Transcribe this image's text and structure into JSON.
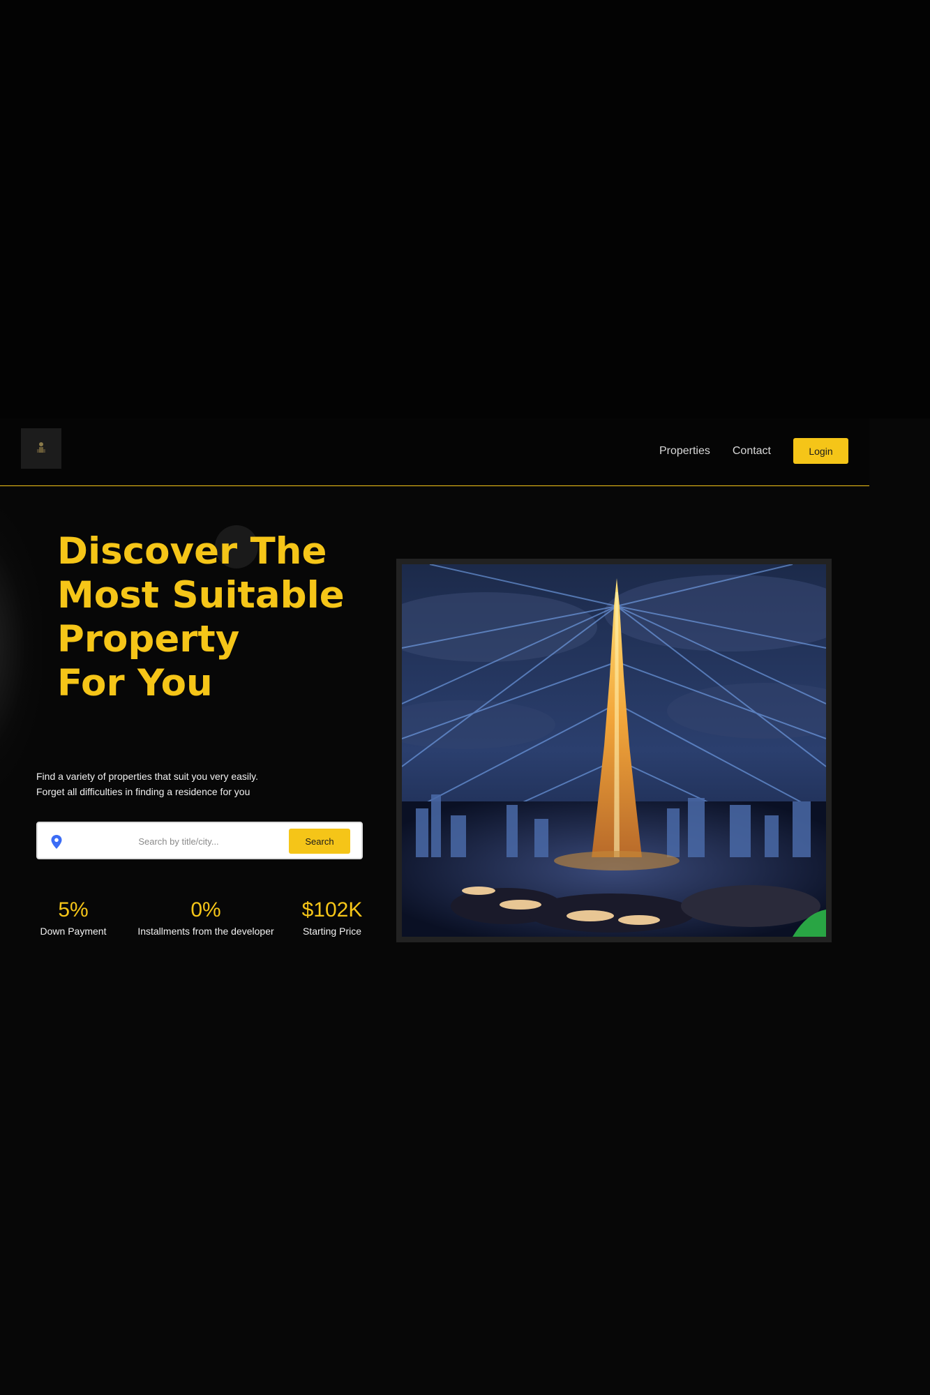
{
  "header": {
    "logo": "logo-icon",
    "nav": [
      {
        "label": "Properties"
      },
      {
        "label": "Contact"
      }
    ],
    "login_label": "Login"
  },
  "hero": {
    "title_lines": [
      "Discover The",
      "Most Suitable",
      "Property",
      "For You"
    ],
    "subtitle_lines": [
      "Find a variety of properties that suit you very easily.",
      "Forget all difficulties in finding a residence for you"
    ],
    "search": {
      "placeholder": "Search by title/city...",
      "value": "",
      "button_label": "Search",
      "icon": "location-pin-icon"
    },
    "stats": [
      {
        "value": "5%",
        "label": "Down Payment"
      },
      {
        "value": "0%",
        "label": "Installments from the developer"
      },
      {
        "value": "$102K",
        "label": "Starting Price"
      }
    ],
    "image": "burj-khalifa-night-light-show"
  },
  "colors": {
    "accent": "#f5c518",
    "background": "#070707",
    "pin": "#3b6cf5"
  }
}
